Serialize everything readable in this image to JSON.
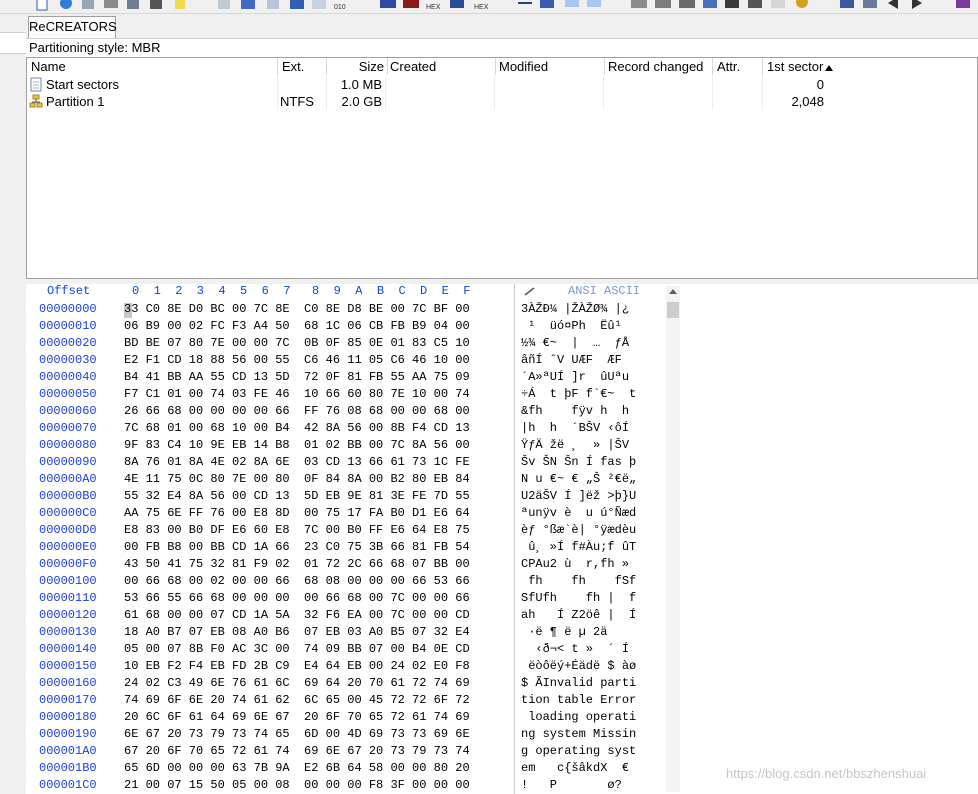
{
  "tab": {
    "label": "ReCREATORS"
  },
  "partitioning_style": "Partitioning style: MBR",
  "list": {
    "columns": [
      "Name",
      "Ext.",
      "Size",
      "Created",
      "Modified",
      "Record changed",
      "Attr.",
      "1st sector"
    ],
    "rows": [
      {
        "name": "Start sectors",
        "ext": "",
        "size": "1.0 MB",
        "first_sector": "0",
        "icon": "document-icon"
      },
      {
        "name": "Partition 1",
        "ext": "NTFS",
        "size": "2.0 GB",
        "first_sector": "2,048",
        "icon": "partition-icon"
      }
    ]
  },
  "hex": {
    "offset_header": "Offset",
    "col_header": "0  1  2  3  4  5  6  7   8  9  A  B  C  D  E  F",
    "ansi_header": "ANSI ASCII",
    "ansi_tab_icon": "pencil-icon",
    "rows": [
      {
        "off": "00000000",
        "bytes": "33 C0 8E D0 BC 00 7C 8E  C0 8E D8 BE 00 7C BF 00",
        "ansi": "3ÀŽÐ¼ |ŽÀŽØ¾ |¿"
      },
      {
        "off": "00000010",
        "bytes": "06 B9 00 02 FC F3 A4 50  68 1C 06 CB FB B9 04 00",
        "ansi": " ¹  üó¤Ph  Ëû¹"
      },
      {
        "off": "00000020",
        "bytes": "BD BE 07 80 7E 00 00 7C  0B 0F 85 0E 01 83 C5 10",
        "ansi": "½¾ €~  |  …  ƒÅ"
      },
      {
        "off": "00000030",
        "bytes": "E2 F1 CD 18 88 56 00 55  C6 46 11 05 C6 46 10 00",
        "ansi": "âñÍ ˆV UÆF  ÆF"
      },
      {
        "off": "00000040",
        "bytes": "B4 41 BB AA 55 CD 13 5D  72 0F 81 FB 55 AA 75 09",
        "ansi": "´A»ªUÍ ]r  ûUªu"
      },
      {
        "off": "00000050",
        "bytes": "F7 C1 01 00 74 03 FE 46  10 66 60 80 7E 10 00 74",
        "ansi": "÷Á  t þF f`€~  t"
      },
      {
        "off": "00000060",
        "bytes": "26 66 68 00 00 00 00 66  FF 76 08 68 00 00 68 00",
        "ansi": "&fh    fÿv h  h"
      },
      {
        "off": "00000070",
        "bytes": "7C 68 01 00 68 10 00 B4  42 8A 56 00 8B F4 CD 13",
        "ansi": "|h  h  ´BŠV ‹ôÍ"
      },
      {
        "off": "00000080",
        "bytes": "9F 83 C4 10 9E EB 14 B8  01 02 BB 00 7C 8A 56 00",
        "ansi": "ŸƒÄ žë ¸  » |ŠV"
      },
      {
        "off": "00000090",
        "bytes": "8A 76 01 8A 4E 02 8A 6E  03 CD 13 66 61 73 1C FE",
        "ansi": "Šv ŠN Šn Í fas þ"
      },
      {
        "off": "000000A0",
        "bytes": "4E 11 75 0C 80 7E 00 80  0F 84 8A 00 B2 80 EB 84",
        "ansi": "N u €~ € „Š ²€ë„"
      },
      {
        "off": "000000B0",
        "bytes": "55 32 E4 8A 56 00 CD 13  5D EB 9E 81 3E FE 7D 55",
        "ansi": "U2äŠV Í ]ëž >þ}U"
      },
      {
        "off": "000000C0",
        "bytes": "AA 75 6E FF 76 00 E8 8D  00 75 17 FA B0 D1 E6 64",
        "ansi": "ªunÿv è  u ú°Ñæd"
      },
      {
        "off": "000000D0",
        "bytes": "E8 83 00 B0 DF E6 60 E8  7C 00 B0 FF E6 64 E8 75",
        "ansi": "èƒ °ßæ`è| °ÿædèu"
      },
      {
        "off": "000000E0",
        "bytes": "00 FB B8 00 BB CD 1A 66  23 C0 75 3B 66 81 FB 54",
        "ansi": " û¸ »Í f#Àu;f ûT"
      },
      {
        "off": "000000F0",
        "bytes": "43 50 41 75 32 81 F9 02  01 72 2C 66 68 07 BB 00",
        "ansi": "CPAu2 ù  r,fh »"
      },
      {
        "off": "00000100",
        "bytes": "00 66 68 00 02 00 00 66  68 08 00 00 00 66 53 66",
        "ansi": " fh    fh    fSf"
      },
      {
        "off": "00000110",
        "bytes": "53 66 55 66 68 00 00 00  00 66 68 00 7C 00 00 66",
        "ansi": "SfUfh    fh |  f"
      },
      {
        "off": "00000120",
        "bytes": "61 68 00 00 07 CD 1A 5A  32 F6 EA 00 7C 00 00 CD",
        "ansi": "ah   Í Z2öê |  Í"
      },
      {
        "off": "00000130",
        "bytes": "18 A0 B7 07 EB 08 A0 B6  07 EB 03 A0 B5 07 32 E4",
        "ansi": " ·ë ¶ ë µ 2ä"
      },
      {
        "off": "00000140",
        "bytes": "05 00 07 8B F0 AC 3C 00  74 09 BB 07 00 B4 0E CD",
        "ansi": "  ‹ð¬< t »  ´ Í"
      },
      {
        "off": "00000150",
        "bytes": "10 EB F2 F4 EB FD 2B C9  E4 64 EB 00 24 02 E0 F8",
        "ansi": " ëòôëý+Éädë $ àø"
      },
      {
        "off": "00000160",
        "bytes": "24 02 C3 49 6E 76 61 6C  69 64 20 70 61 72 74 69",
        "ansi": "$ ÃInvalid parti"
      },
      {
        "off": "00000170",
        "bytes": "74 69 6F 6E 20 74 61 62  6C 65 00 45 72 72 6F 72",
        "ansi": "tion table Error"
      },
      {
        "off": "00000180",
        "bytes": "20 6C 6F 61 64 69 6E 67  20 6F 70 65 72 61 74 69",
        "ansi": " loading operati"
      },
      {
        "off": "00000190",
        "bytes": "6E 67 20 73 79 73 74 65  6D 00 4D 69 73 73 69 6E",
        "ansi": "ng system Missin"
      },
      {
        "off": "000001A0",
        "bytes": "67 20 6F 70 65 72 61 74  69 6E 67 20 73 79 73 74",
        "ansi": "g operating syst"
      },
      {
        "off": "000001B0",
        "bytes": "65 6D 00 00 00 63 7B 9A  E2 6B 64 58 00 00 80 20",
        "ansi": "em   c{šâkdX  €"
      },
      {
        "off": "000001C0",
        "bytes": "21 00 07 15 50 05 00 08  00 00 00 F8 3F 00 00 00",
        "ansi": "!   P       ø?"
      }
    ]
  },
  "watermark": "https://blog.csdn.net/bbszhenshuai",
  "toolbar_icons": [
    "new-icon",
    "open-icon",
    "save-icon",
    "print-icon",
    "properties-icon",
    "bookmark-icon",
    "cut-icon",
    "copy-icon",
    "paste-icon",
    "paste-special-icon",
    "hex-icon",
    "binoculars-icon",
    "find-hex-icon",
    "replace-icon",
    "replace-hex-icon",
    "goto-icon",
    "goto-sector-icon",
    "back-icon",
    "forward-icon",
    "disk-icon",
    "disk2-icon",
    "ram-icon",
    "calculator-icon",
    "search-icon",
    "settings-icon",
    "user-icon",
    "gear-icon",
    "network-icon",
    "compare-icon",
    "prev-icon",
    "next-icon",
    "book-icon"
  ]
}
